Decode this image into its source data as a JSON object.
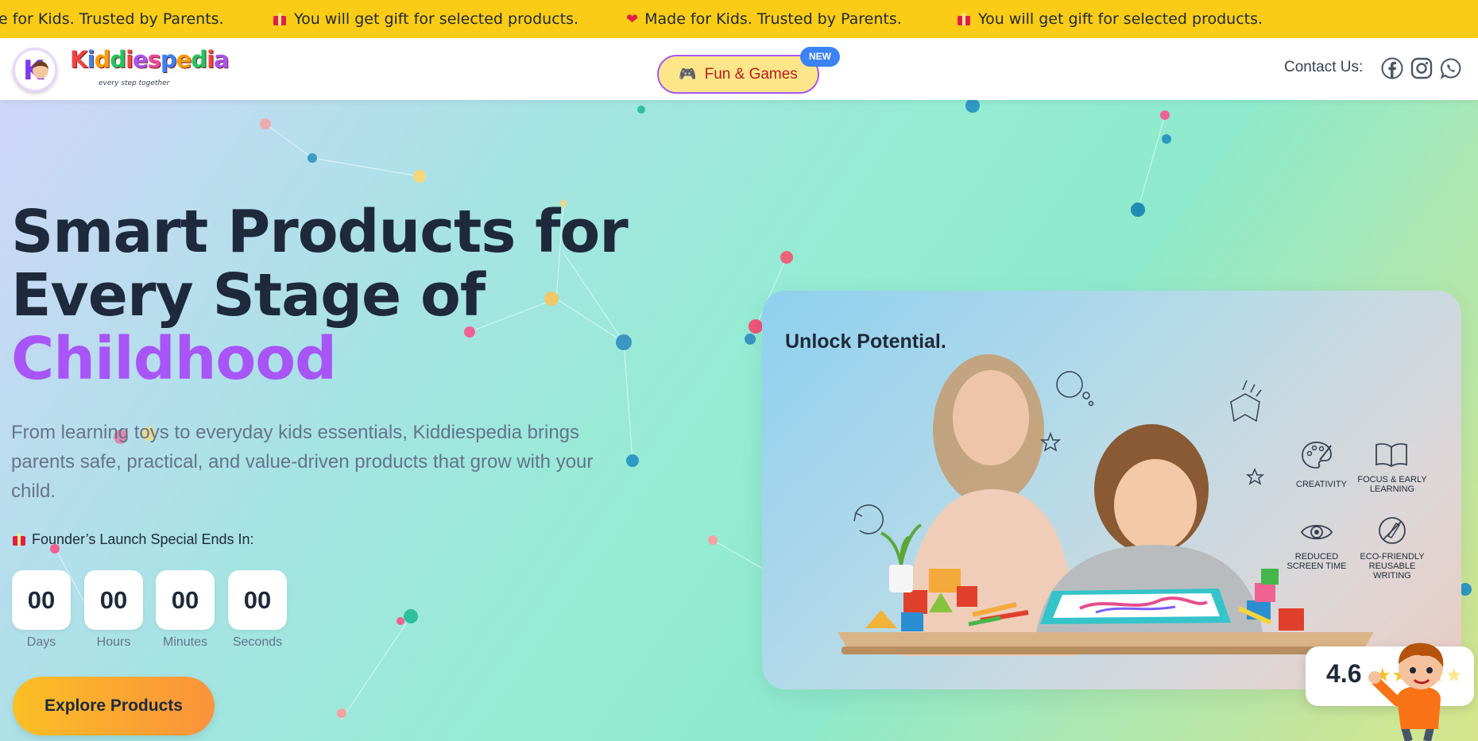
{
  "announcement": {
    "items": [
      "e for Kids. Trusted by Parents.",
      "You will get gift for selected products.",
      "Made for Kids. Trusted by Parents.",
      "You will get gift for selected products."
    ],
    "icons": [
      "none",
      "gift-icon",
      "heart-icon",
      "gift-icon"
    ]
  },
  "header": {
    "logo_text": "Kiddiespedia",
    "logo_letters": [
      "K",
      "i",
      "d",
      "d",
      "i",
      "e",
      "s",
      "p",
      "e",
      "d",
      "i",
      "a"
    ],
    "logo_colors": [
      "#ef4444",
      "#3b82f6",
      "#f59e0b",
      "#22c55e",
      "#ef4444",
      "#a855f7",
      "#ec4899",
      "#3b82f6",
      "#f59e0b",
      "#22c55e",
      "#ef4444",
      "#a855f7"
    ],
    "tagline": "every step together",
    "fun_button_label": "Fun & Games",
    "new_badge": "NEW",
    "contact_label": "Contact Us:",
    "social_icons": [
      "facebook-icon",
      "instagram-icon",
      "whatsapp-icon"
    ]
  },
  "hero": {
    "headline_line1": "Smart Products for",
    "headline_line2": "Every Stage of",
    "headline_accent": "Childhood",
    "subtext": "From learning toys to everyday kids essentials, Kiddiespedia brings parents safe, practical, and value-driven products that grow with your child.",
    "launch_label": "Founder’s Launch Special Ends In:",
    "countdown": [
      {
        "value": "00",
        "label": "Days"
      },
      {
        "value": "00",
        "label": "Hours"
      },
      {
        "value": "00",
        "label": "Minutes"
      },
      {
        "value": "00",
        "label": "Seconds"
      }
    ],
    "cta_label": "Explore Products"
  },
  "promo_card": {
    "title": "Unlock Potential.",
    "features": [
      {
        "icon": "palette-icon",
        "label": "Creativity"
      },
      {
        "icon": "book-icon",
        "label": "Focus & Early Learning"
      },
      {
        "icon": "eye-icon",
        "label": "Reduced Screen Time"
      },
      {
        "icon": "eco-pen-icon",
        "label": "Eco-Friendly Reusable Writing"
      }
    ]
  },
  "rating": {
    "value": "4.6",
    "stars_filled": 4.6,
    "stars_total": 5
  },
  "colors": {
    "topbar": "#facc15",
    "accent_purple": "#a855f7",
    "cta_start": "#fbbf24",
    "cta_end": "#fb923c",
    "badge_blue": "#3b82f6"
  }
}
